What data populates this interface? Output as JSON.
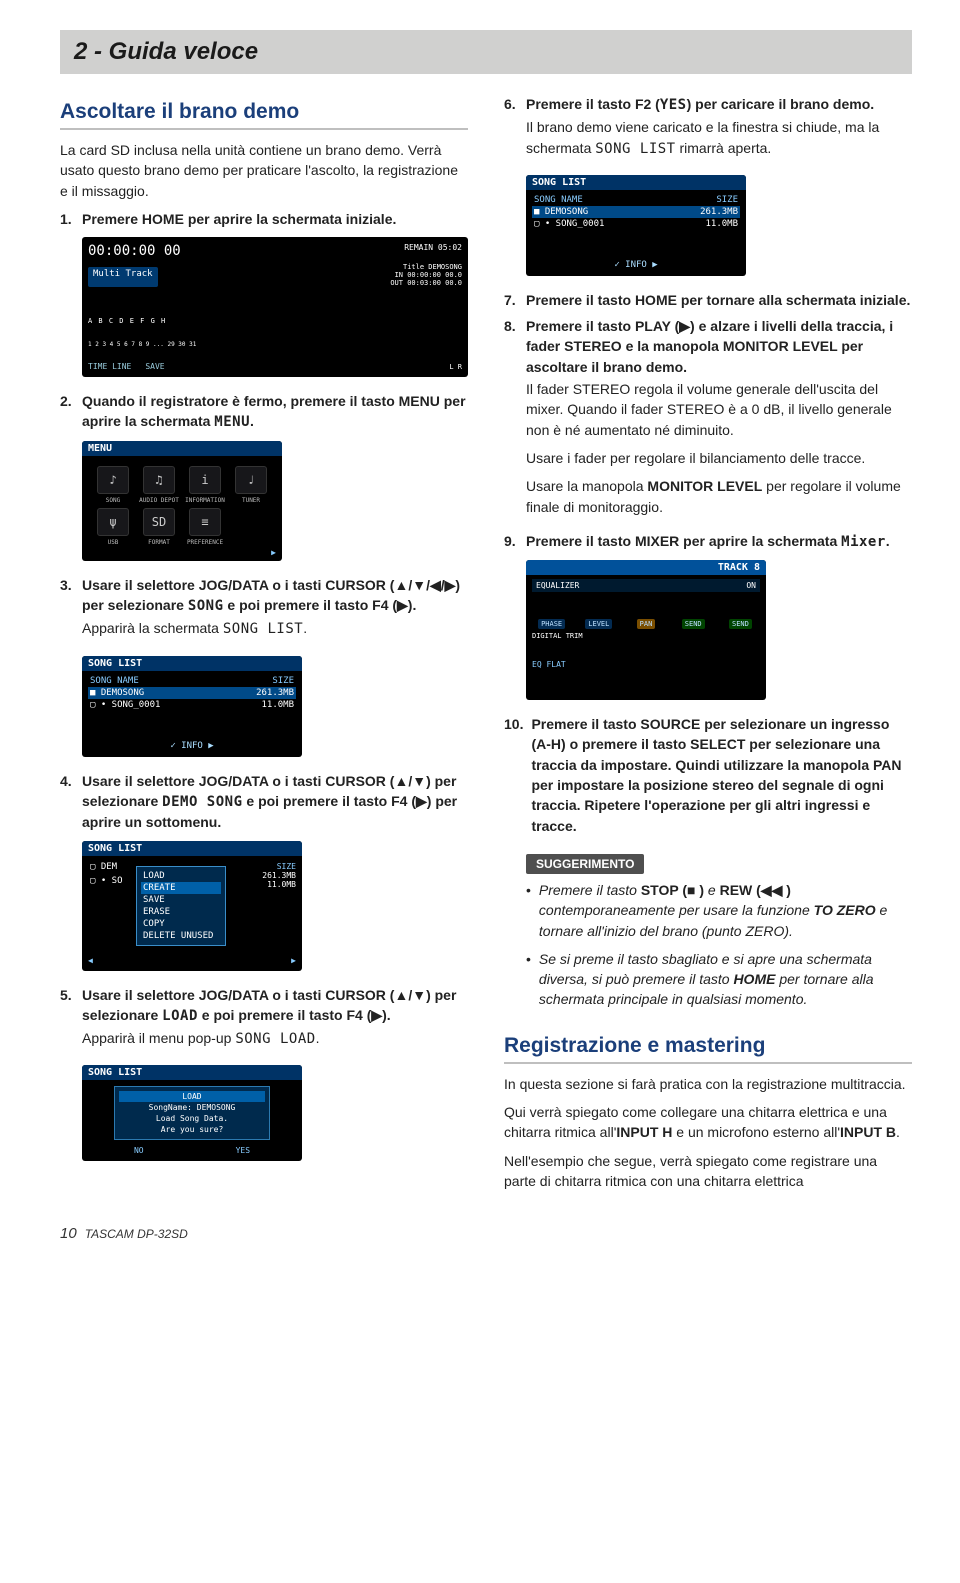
{
  "header": {
    "chapter": "2 - Guida veloce"
  },
  "left": {
    "h_listen": "Ascoltare il brano demo",
    "intro1": "La card SD inclusa nella unità contiene un brano demo. Verrà usato questo brano demo per praticare l'ascolto, la registrazione e il missaggio.",
    "s1": "Premere HOME per aprire la schermata iniziale.",
    "home": {
      "time": "00:00:00 00",
      "remain": "REMAIN 05:02",
      "multi": "Multi Track",
      "title": "Title DEMOSONG",
      "in": "IN   00:00:00 00.0",
      "out": "OUT  00:03:00 00.0",
      "letters": "A B C D E F G H",
      "nums": "1 2 3 4 5 6 7 8 9 ... 29 30 31",
      "tl": "TIME LINE",
      "sv": "SAVE"
    },
    "s2_a": "Quando il registratore è fermo, premere il tasto MENU per aprire la schermata ",
    "s2_b": "MENU",
    "s2_c": ".",
    "menu": {
      "bar": "MENU",
      "tiles": [
        {
          "ico": "♪",
          "lbl": "SONG"
        },
        {
          "ico": "♫",
          "lbl": "AUDIO DEPOT"
        },
        {
          "ico": "i",
          "lbl": "INFORMATION"
        },
        {
          "ico": "♩",
          "lbl": "TUNER"
        },
        {
          "ico": "ψ",
          "lbl": "USB"
        },
        {
          "ico": "SD",
          "lbl": "FORMAT"
        },
        {
          "ico": "≡",
          "lbl": "PREFERENCE"
        }
      ]
    },
    "s3_a": "Usare il selettore JOG/DATA o i tasti CURSOR (▲/▼/◀/▶) per selezionare ",
    "s3_b": "SONG",
    "s3_c": " e poi premere il tasto F4 (▶).",
    "s3_d": "Apparirà la schermata ",
    "s3_e": "SONG LIST",
    "s3_f": ".",
    "songlist": {
      "bar": "SONG LIST",
      "h1": "SONG NAME",
      "h2": "SIZE",
      "r1a": "■  DEMOSONG",
      "r1b": "261.3MB",
      "r2a": "▢ • SONG_0001",
      "r2b": "11.0MB",
      "info": "✓     INFO     ▶"
    },
    "s4_a": "Usare il selettore JOG/DATA o i tasti CURSOR (▲/▼) per selezionare ",
    "s4_b": "DEMO SONG",
    "s4_c": " e poi premere il tasto F4 (▶) per aprire un sottomenu.",
    "popup1": {
      "items": [
        "LOAD",
        "CREATE",
        "SAVE",
        "ERASE",
        "COPY",
        "DELETE UNUSED"
      ],
      "sel": 1
    },
    "s5_a": "Usare il selettore JOG/DATA o i tasti CURSOR (▲/▼) per selezionare ",
    "s5_b": "LOAD",
    "s5_c": " e poi premere il tasto F4 (▶).",
    "s5_d": "Apparirà il menu pop-up ",
    "s5_e": "SONG LOAD",
    "s5_f": ".",
    "dialog": {
      "top": "LOAD",
      "name": "SongName: DEMOSONG",
      "msg": "Load Song Data.",
      "q": "Are you sure?",
      "no": "NO",
      "yes": "YES"
    }
  },
  "right": {
    "s6_a": "Premere il tasto F2 (",
    "s6_b": "YES",
    "s6_c": ") per caricare il brano demo.",
    "s6_d": "Il brano demo viene caricato e la finestra si chiude, ma la schermata ",
    "s6_e": "SONG LIST",
    "s6_f": " rimarrà aperta.",
    "s7": "Premere il tasto HOME per tornare alla schermata iniziale.",
    "s8_a": "Premere il tasto PLAY (▶) e alzare i livelli della traccia, i fader STEREO e la manopola MONITOR LEVEL per ascoltare il brano demo.",
    "s8_b": "Il fader STEREO regola il volume generale dell'uscita del mixer. Quando il fader STEREO è a 0 dB, il livello generale non è né aumentato né diminuito.",
    "s8_c": "Usare i fader per regolare il bilanciamento delle tracce.",
    "s8_d_a": "Usare la manopola ",
    "s8_d_b": "MONITOR LEVEL",
    "s8_d_c": " per regolare il volume finale di monitoraggio.",
    "s9_a": "Premere il tasto MIXER per aprire la schermata ",
    "s9_b": "Mixer",
    "s9_c": ".",
    "mixer": {
      "trk": "TRACK 8",
      "eq": "EQUALIZER",
      "labels": [
        "PHASE",
        "LEVEL",
        "PAN",
        "SEND",
        "SEND"
      ],
      "bottom": "EQ FLAT"
    },
    "s10": "Premere il tasto SOURCE per selezionare un ingresso (A-H) o premere il tasto SELECT per selezionare una traccia da impostare. Quindi utilizzare la manopola PAN per impostare la posizione stereo del segnale di ogni traccia. Ripetere l'operazione per gli altri ingressi e tracce.",
    "tip_label": "SUGGERIMENTO",
    "tip1_a": "Premere il tasto ",
    "tip1_b": "STOP (■ )",
    "tip1_c": " e ",
    "tip1_d": "REW (◀◀ )",
    "tip1_e": " contemporaneamente per usare la funzione ",
    "tip1_f": "TO ZERO",
    "tip1_g": " e tornare all'inizio del brano (punto ZERO).",
    "tip2_a": "Se si preme il tasto sbagliato e si apre una schermata diversa, si può premere il tasto ",
    "tip2_b": "HOME",
    "tip2_c": " per tornare alla schermata principale in qualsiasi momento.",
    "h_rec": "Registrazione e mastering",
    "rec1": "In questa sezione si farà pratica con la registrazione multitraccia.",
    "rec2_a": "Qui verrà spiegato come collegare una chitarra elettrica e una chitarra ritmica all'",
    "rec2_b": "INPUT H",
    "rec2_c": " e un microfono esterno all'",
    "rec2_d": "INPUT B",
    "rec2_e": ".",
    "rec3": "Nell'esempio che segue, verrà spiegato come registrare una parte di chitarra ritmica con una chitarra elettrica"
  },
  "footer": {
    "page": "10",
    "product": "TASCAM DP-32SD"
  }
}
